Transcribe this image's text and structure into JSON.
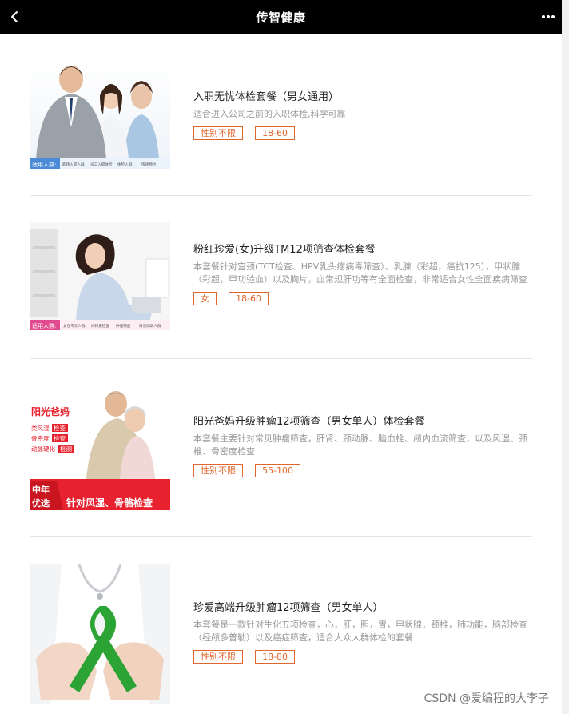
{
  "header": {
    "title": "传智健康",
    "back_icon": "chevron-left-icon",
    "more_icon": "more-dots-icon"
  },
  "packages": [
    {
      "name": "入职无忧体检套餐（男女通用）",
      "desc": "适合进入公司之前的入职体检,科学可靠",
      "tags": [
        "性别不限",
        "18-60"
      ],
      "image": {
        "banner_label": "适用人群:",
        "banner_items": [
          "职场入职人群",
          "员工入职体检",
          "体检人群",
          "快速预约"
        ]
      }
    },
    {
      "name": "粉红珍爱(女)升级TM12项筛查体检套餐",
      "desc": "本套餐针对宫颈(TCT检查、HPV乳头瘤病毒筛查）、乳腺（彩超，癌抗125），甲状腺（彩超，甲功验血）以及胸片，血常规肝功等有全面检查，非常适合女性全面疾病筛查",
      "tags": [
        "女",
        "18-60"
      ],
      "image": {
        "banner_label": "适用人群:",
        "banner_items": [
          "女性专享人群",
          "妇科重检查",
          "肿瘤筛查",
          "白领高端人群"
        ]
      }
    },
    {
      "name": "阳光爸妈升级肿瘤12项筛查（男女单人）体检套餐",
      "desc": "本套餐主要针对常见肿瘤筛查，肝肾、颈动脉、脑血栓、颅内血流筛查，以及风湿、颈椎、骨密度检查",
      "tags": [
        "性别不限",
        "55-100"
      ],
      "image": {
        "headline": "阳光爸妈",
        "checks": [
          {
            "label": "类风湿",
            "badge": "检查"
          },
          {
            "label": "骨密度",
            "badge": "检查"
          },
          {
            "label": "动脉硬化",
            "badge": "检测"
          }
        ],
        "corner": [
          "中年",
          "优选"
        ],
        "bottom": "针对风湿、骨骼检查"
      }
    },
    {
      "name": "珍爱高端升级肿瘤12项筛查（男女单人）",
      "desc": "本套餐是一款针对生化五项检查，心，肝，胆，胃，甲状腺，颈椎，肺功能，脑部检查（经颅多普勒）以及癌症筛查，适合大众人群体检的套餐",
      "tags": [
        "性别不限",
        "18-80"
      ],
      "image": {}
    }
  ],
  "watermark": "CSDN @爱编程的大李子",
  "colors": {
    "tag": "#e0662e",
    "header_bg": "#000000",
    "poster_red": "#e8212e"
  }
}
